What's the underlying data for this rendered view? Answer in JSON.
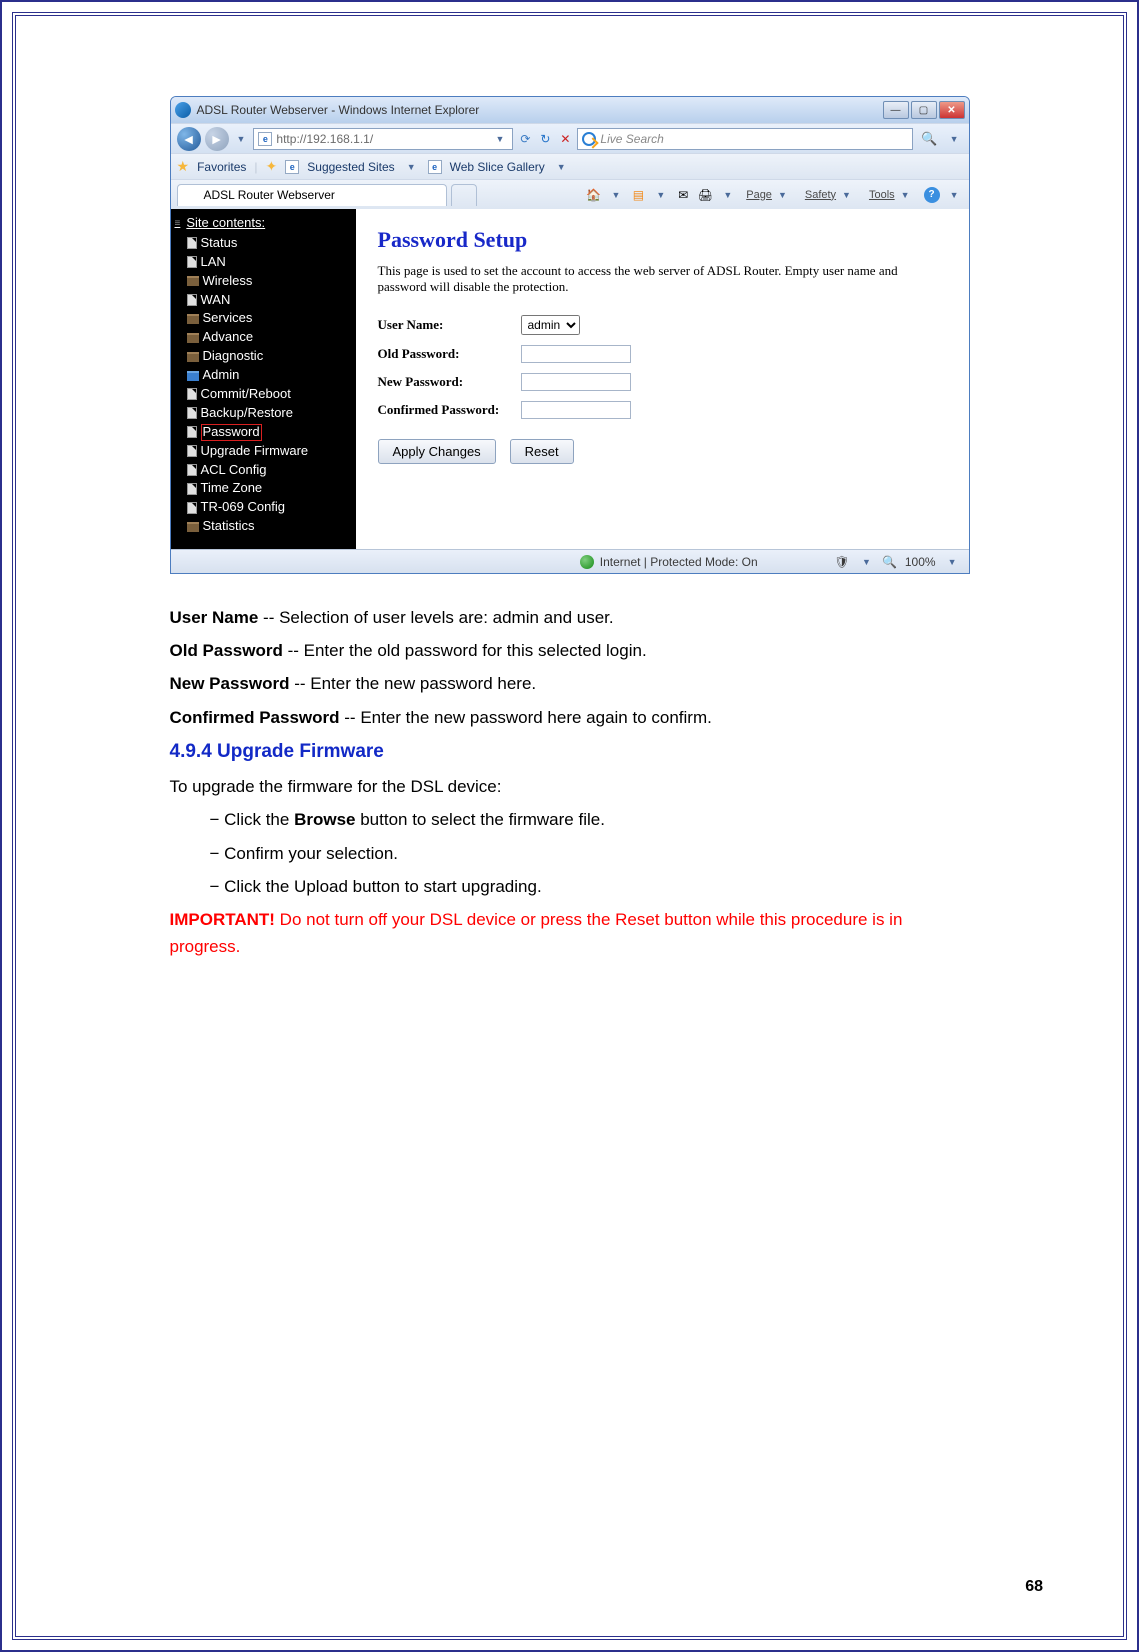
{
  "browser": {
    "title": "ADSL Router Webserver - Windows Internet Explorer",
    "address": "http://192.168.1.1/",
    "search_placeholder": "Live Search",
    "favorites_label": "Favorites",
    "fav_links": [
      "Suggested Sites",
      "Web Slice Gallery"
    ],
    "tab_title": "ADSL Router Webserver",
    "toolbar": {
      "page": "Page",
      "safety": "Safety",
      "tools": "Tools"
    },
    "status": "Internet | Protected Mode: On",
    "zoom": "100%"
  },
  "sidebar": {
    "root": "Site contents:",
    "items": [
      "Status",
      "LAN",
      "Wireless",
      "WAN",
      "Services",
      "Advance",
      "Diagnostic"
    ],
    "admin_label": "Admin",
    "admin_children": [
      "Commit/Reboot",
      "Backup/Restore",
      "Password",
      "Upgrade Firmware",
      "ACL Config",
      "Time Zone",
      "TR-069 Config"
    ],
    "after": [
      "Statistics"
    ],
    "selected": "Password"
  },
  "form": {
    "heading": "Password Setup",
    "desc": "This page is used to set the account to access the web server of ADSL Router. Empty user name and password will disable the protection.",
    "username_label": "User Name:",
    "username_value": "admin",
    "old_label": "Old Password:",
    "new_label": "New Password:",
    "conf_label": "Confirmed Password:",
    "apply_btn": "Apply Changes",
    "reset_btn": "Reset"
  },
  "doc": {
    "un_t": "User Name",
    "un_d": " -- Selection of user levels are: admin and user.",
    "op_t": "Old Password",
    "op_d": " -- Enter the old password for this selected login.",
    "np_t": "New Password",
    "np_d": " -- Enter the new password here.",
    "cp_t": "Confirmed Password",
    "cp_d": " -- Enter the new password here again to confirm.",
    "section": "4.9.4 Upgrade Firmware",
    "intro": "To upgrade the firmware for the DSL device:",
    "step1_pre": "− Click the ",
    "step1_bold": "Browse",
    "step1_post": " button to select the firmware file.",
    "step2": "− Confirm your selection.",
    "step3": "− Click the Upload button to start upgrading.",
    "imp_label": "IMPORTANT!",
    "imp_text": " Do not turn off your DSL device or press the Reset button while this procedure is in progress."
  },
  "page_number": "68"
}
